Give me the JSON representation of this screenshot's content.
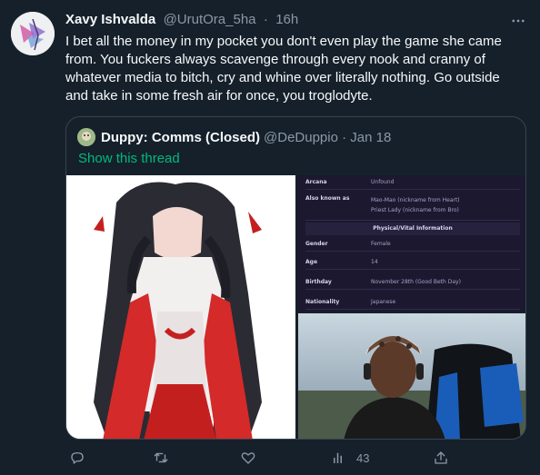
{
  "tweet": {
    "author_name": "Xavy Ishvalda",
    "author_handle": "@UrutOra_5ha",
    "separator": "·",
    "time": "16h",
    "text": "I bet all the money in my pocket you don't even play the game she came from. You fuckers always scavenge through every nook and cranny of whatever media to bitch, cry and whine over literally nothing. Go outside and take in some fresh air for once, you troglodyte."
  },
  "quoted_tweet": {
    "author_name": "Duppy: Comms (Closed)",
    "author_handle": "@DeDuppio",
    "separator": "·",
    "date": "Jan 18",
    "show_thread": "Show this thread"
  },
  "info_card": {
    "rows_top": [
      {
        "key": "Arcana",
        "value": "Unfound"
      },
      {
        "key": "Also known as",
        "value": "Mao-Mao (nickname from Heart)\nPriest Lady (nickname from Bro)"
      }
    ],
    "section_title": "Physical/Vital Information",
    "rows_bottom": [
      {
        "key": "Gender",
        "value": "Female"
      },
      {
        "key": "Age",
        "value": "14"
      },
      {
        "key": "Birthday",
        "value": "November 28th (Good Beth Day)"
      },
      {
        "key": "Nationality",
        "value": "Japanese"
      }
    ]
  },
  "actions": {
    "views_count": "43"
  },
  "icons": {
    "more": "more-icon",
    "reply": "reply-icon",
    "retweet": "retweet-icon",
    "like": "like-icon",
    "views": "views-icon",
    "share": "share-icon"
  },
  "colors": {
    "background": "#15202b",
    "text": "#f7f9f9",
    "muted": "#8b98a5",
    "border": "#38444d",
    "show_thread": "#00ba7c"
  }
}
